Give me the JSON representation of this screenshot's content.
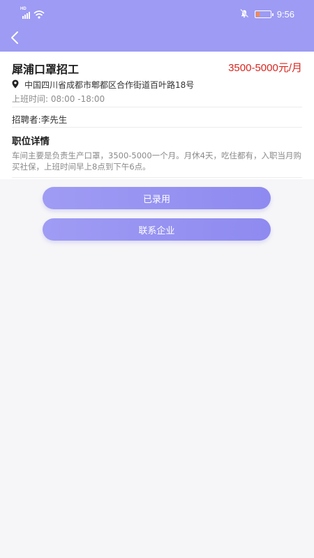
{
  "status_bar": {
    "time": "9:56",
    "network_label": "HD",
    "icons": [
      "signal-icon",
      "wifi-icon",
      "mute-icon",
      "battery-icon"
    ]
  },
  "colors": {
    "header": "#9d9bf3",
    "salary": "#d9251e",
    "button": "#9592f2"
  },
  "job": {
    "title": "犀浦口罩招工",
    "salary": "3500-5000元/月",
    "address": "中国四川省成都市郫都区合作街道百叶路18号",
    "hours": "上班时间: 08:00 -18:00",
    "recruiter": "招聘者:李先生"
  },
  "details": {
    "title": "职位详情",
    "description": "车间主要是负责生产口罩，3500-5000一个月。月休4天，吃住都有，入职当月购买社保，上班时间早上8点到下午6点。"
  },
  "actions": {
    "hired_label": "已录用",
    "contact_label": "联系企业"
  }
}
